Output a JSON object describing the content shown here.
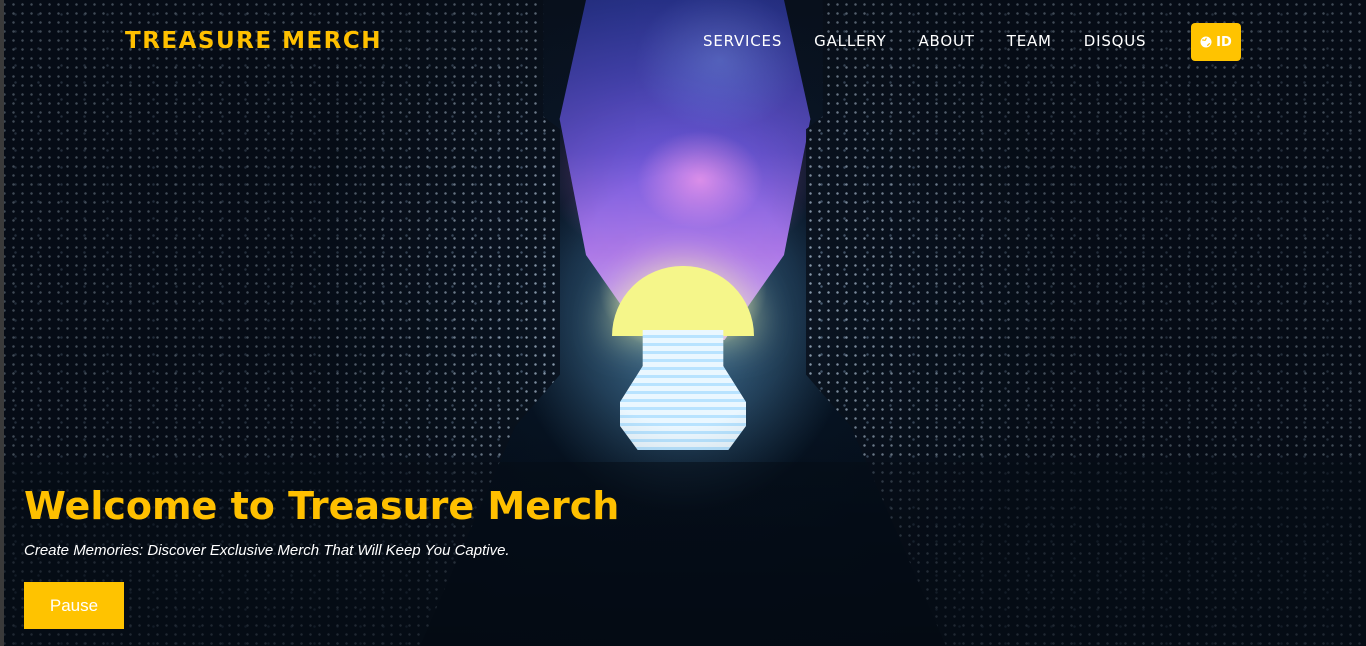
{
  "navbar": {
    "brand": "TREASURE MERCH",
    "links": [
      {
        "label": "SERVICES"
      },
      {
        "label": "GALLERY"
      },
      {
        "label": "ABOUT"
      },
      {
        "label": "TEAM"
      },
      {
        "label": "DISQUS"
      }
    ],
    "language_button": {
      "label": "ID",
      "icon": "globe-icon"
    }
  },
  "hero": {
    "title": "Welcome to Treasure Merch",
    "subtitle": "Create Memories: Discover Exclusive Merch That Will Keep You Captive.",
    "pause_label": "Pause"
  },
  "colors": {
    "accent": "#ffc300",
    "brand_text": "#ffc000",
    "nav_text": "#ffffff"
  }
}
